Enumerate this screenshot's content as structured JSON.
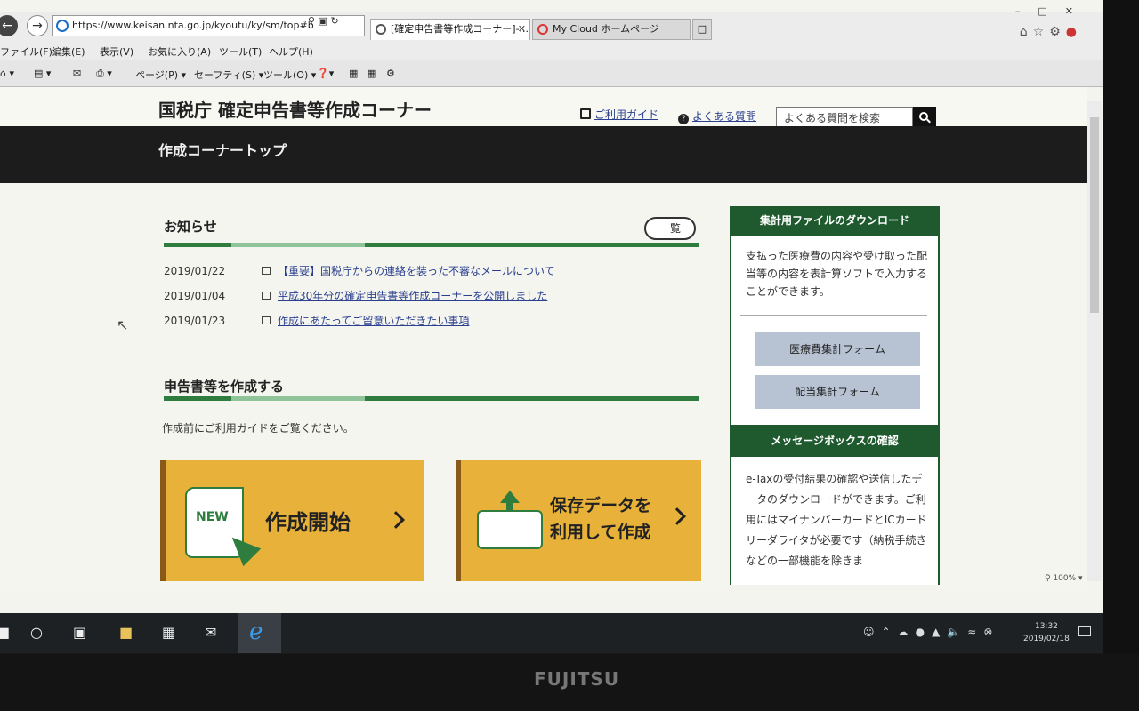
{
  "browser": {
    "url": "https://www.keisan.nta.go.jp/kyoutu/ky/sm/top#b",
    "tabs": [
      {
        "label": "[確定申告書等作成コーナー]-..."
      },
      {
        "label": "My Cloud ホームページ"
      }
    ],
    "menu": [
      "ファイル(F)",
      "編集(E)",
      "表示(V)",
      "お気に入り(A)",
      "ツール(T)",
      "ヘルプ(H)"
    ],
    "commands": [
      "ページ(P) ▾",
      "セーフティ(S) ▾",
      "ツール(O) ▾"
    ],
    "zoom": "100%"
  },
  "header": {
    "site_title": "国税庁 確定申告書等作成コーナー",
    "guide_link": "ご利用ガイド",
    "faq_link": "よくある質問",
    "search_placeholder": "よくある質問を検索"
  },
  "breadcrumb": "作成コーナートップ",
  "news": {
    "title": "お知らせ",
    "list_all": "一覧",
    "items": [
      {
        "date": "2019/01/22",
        "text": "【重要】国税庁からの連絡を装った不審なメールについて"
      },
      {
        "date": "2019/01/04",
        "text": "平成30年分の確定申告書等作成コーナーを公開しました"
      },
      {
        "date": "2019/01/23",
        "text": "作成にあたってご留意いただきたい事項"
      }
    ]
  },
  "create": {
    "title": "申告書等を作成する",
    "note": "作成前にご利用ガイドをご覧ください。",
    "new_badge": "NEW",
    "new_label": "作成開始",
    "saved_label_1": "保存データを",
    "saved_label_2": "利用して作成"
  },
  "sidebar": {
    "download_title": "集計用ファイルのダウンロード",
    "download_text": "支払った医療費の内容や受け取った配当等の内容を表計算ソフトで入力することができます。",
    "medical_form": "医療費集計フォーム",
    "dividend_form": "配当集計フォーム",
    "message_title": "メッセージボックスの確認",
    "message_text": "e-Taxの受付結果の確認や送信したデータのダウンロードができます。ご利用にはマイナンバーカードとICカードリーダライタが必要です（納税手続きなどの一部機能を除きま"
  },
  "taskbar": {
    "time": "13:32",
    "date": "2019/02/18"
  },
  "monitor": {
    "brand": "FUJITSU"
  },
  "colors": {
    "green": "#2e7d3e",
    "orange_button": "#e8b13a",
    "header_black": "#1c1c1c",
    "link_blue": "#2a3f8f"
  }
}
